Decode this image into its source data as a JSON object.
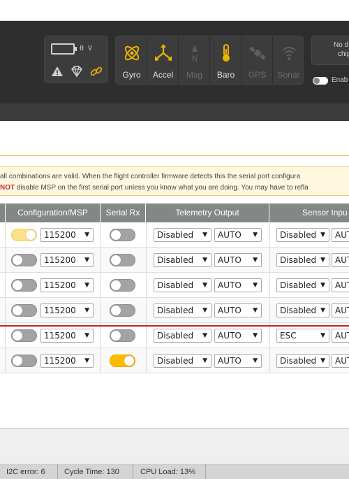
{
  "battery": {
    "voltage": "0 V"
  },
  "sensors": [
    {
      "name": "gyro",
      "label": "Gyro",
      "active": true
    },
    {
      "name": "accel",
      "label": "Accel",
      "active": true
    },
    {
      "name": "mag",
      "label": "Mag",
      "active": false
    },
    {
      "name": "baro",
      "label": "Baro",
      "active": true
    },
    {
      "name": "gps",
      "label": "GPS",
      "active": false
    },
    {
      "name": "sonar",
      "label": "Sonar",
      "active": false
    }
  ],
  "header_right": {
    "nodata_line1": "No d",
    "nodata_line2": "chip",
    "enable_label": "Enab"
  },
  "note": {
    "line1": "all combinations are valid. When the flight controller firmware detects this the serial port configura",
    "line2_strong": "NOT",
    "line2_rest": " disable MSP on the first serial port unless you know what you are doing. You may have to refla"
  },
  "table": {
    "headers": {
      "config_msp": "Configuration/MSP",
      "serial_rx": "Serial Rx",
      "telemetry": "Telemetry Output",
      "sensor_input": "Sensor Inpu"
    },
    "rows": [
      {
        "msp_on": true,
        "msp_baud": "115200",
        "serial_rx_on": false,
        "telemetry": "Disabled",
        "telemetry_baud": "AUTO",
        "sensor": "Disabled",
        "sensor_baud": "AUT"
      },
      {
        "msp_on": false,
        "msp_baud": "115200",
        "serial_rx_on": false,
        "telemetry": "Disabled",
        "telemetry_baud": "AUTO",
        "sensor": "Disabled",
        "sensor_baud": "AUT"
      },
      {
        "msp_on": false,
        "msp_baud": "115200",
        "serial_rx_on": false,
        "telemetry": "Disabled",
        "telemetry_baud": "AUTO",
        "sensor": "Disabled",
        "sensor_baud": "AUT"
      },
      {
        "msp_on": false,
        "msp_baud": "115200",
        "serial_rx_on": false,
        "telemetry": "Disabled",
        "telemetry_baud": "AUTO",
        "sensor": "Disabled",
        "sensor_baud": "AUT"
      },
      {
        "msp_on": false,
        "msp_baud": "115200",
        "serial_rx_on": false,
        "telemetry": "Disabled",
        "telemetry_baud": "AUTO",
        "sensor": "ESC",
        "sensor_baud": "AUT"
      },
      {
        "msp_on": false,
        "msp_baud": "115200",
        "serial_rx_on": true,
        "telemetry": "Disabled",
        "telemetry_baud": "AUTO",
        "sensor": "Disabled",
        "sensor_baud": "AUT"
      }
    ]
  },
  "statusbar": {
    "i2c": "I2C error: 6",
    "cycle": "Cycle Time: 130",
    "cpu": "CPU Load: 13%"
  },
  "colors": {
    "header_bg": "#2e2e2e",
    "accent": "#ffbb00",
    "warning_red": "#c9302c",
    "marker_red": "#c8202a"
  }
}
